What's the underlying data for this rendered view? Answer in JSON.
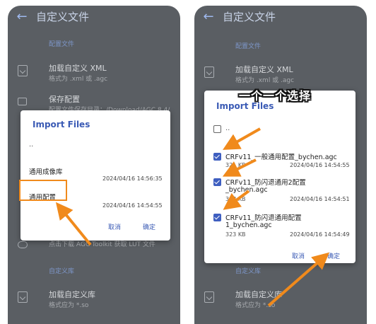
{
  "left": {
    "app_title": "自定义文件",
    "section_config": "配置文件",
    "items": [
      {
        "title": "加载自定义 XML",
        "sub": "格式为 .xml 或 .agc"
      },
      {
        "title": "保存配置",
        "sub": "配置文件保存目录：/Download/AGC.8.4/"
      }
    ],
    "below_dialog_text": "点击下载 AGC Toolkit 获取 LUT 文件",
    "section_lib": "自定义库",
    "lib_items": [
      {
        "title": "加载自定义库",
        "sub": "格式应为 *.so"
      }
    ],
    "dialog": {
      "title": "Import Files",
      "up": "..",
      "files": [
        {
          "name": "通用成像库",
          "date": "2024/04/16 14:56:35"
        },
        {
          "name": "通用配置",
          "date": "2024/04/16 14:54:55"
        }
      ],
      "cancel": "取消",
      "ok": "确定"
    }
  },
  "right": {
    "app_title": "自定义文件",
    "section_config": "配置文件",
    "items": [
      {
        "title": "加载自定义 XML",
        "sub": "格式为 .xml 或 .agc"
      }
    ],
    "section_lib": "自定义库",
    "lib_items": [
      {
        "title": "加载自定义库",
        "sub": "格式应为 *.so"
      }
    ],
    "dialog": {
      "title": "Import Files",
      "up": "..",
      "files": [
        {
          "name": "CRFv11_一般通用配置_bychen.agc",
          "size": "321 KB",
          "date": "2024/04/16 14:54:55"
        },
        {
          "name": "CRFv11_防闪退通用2配置",
          "name2": "_bychen.agc",
          "size": "318 KB",
          "date": "2024/04/16 14:54:51"
        },
        {
          "name": "CRFv11_防闪退通用配置",
          "name2": "1_bychen.agc",
          "size": "323 KB",
          "date": "2024/04/16 14:54:49"
        }
      ],
      "cancel": "取消",
      "ok": "确定"
    }
  },
  "caption": "一个一个选择",
  "colors": {
    "accent": "#3b5bb5",
    "annotation": "#f08a1c",
    "scrim": "#5a5e63"
  }
}
